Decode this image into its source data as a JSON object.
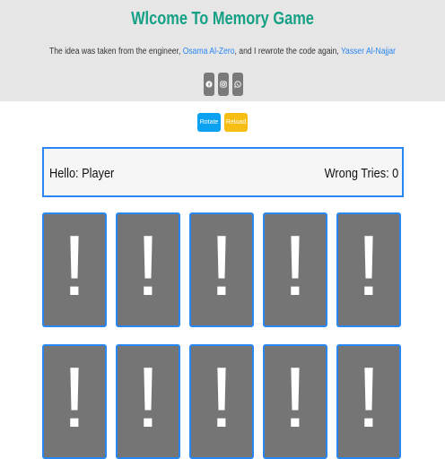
{
  "header": {
    "title": "Wlcome To Memory Game",
    "intro_prefix": "The idea was taken from the engineer,",
    "engineer_link": "Osama Al-Zero",
    "intro_middle": ", and I rewrote the code again,",
    "author_link": "Yasser Al-Najjar",
    "socials": [
      {
        "icon": "facebook-icon"
      },
      {
        "icon": "instagram-icon"
      },
      {
        "icon": "whatsapp-icon"
      }
    ]
  },
  "controls": {
    "rotate_label": "Rotate",
    "reload_label": "Reload"
  },
  "info": {
    "hello_label": "Hello: Player",
    "tries_label": "Wrong Tries: 0"
  },
  "board": {
    "cards": [
      {
        "face": "!"
      },
      {
        "face": "!"
      },
      {
        "face": "!"
      },
      {
        "face": "!"
      },
      {
        "face": "!"
      },
      {
        "face": "!"
      },
      {
        "face": "!"
      },
      {
        "face": "!"
      },
      {
        "face": "!"
      },
      {
        "face": "!"
      }
    ]
  },
  "colors": {
    "title": "#16a085",
    "link": "#2a86f2",
    "rotate_button": "#0aa1f0",
    "reload_button": "#f6bd12",
    "card_back": "#757575",
    "card_border": "#2a86f2"
  }
}
